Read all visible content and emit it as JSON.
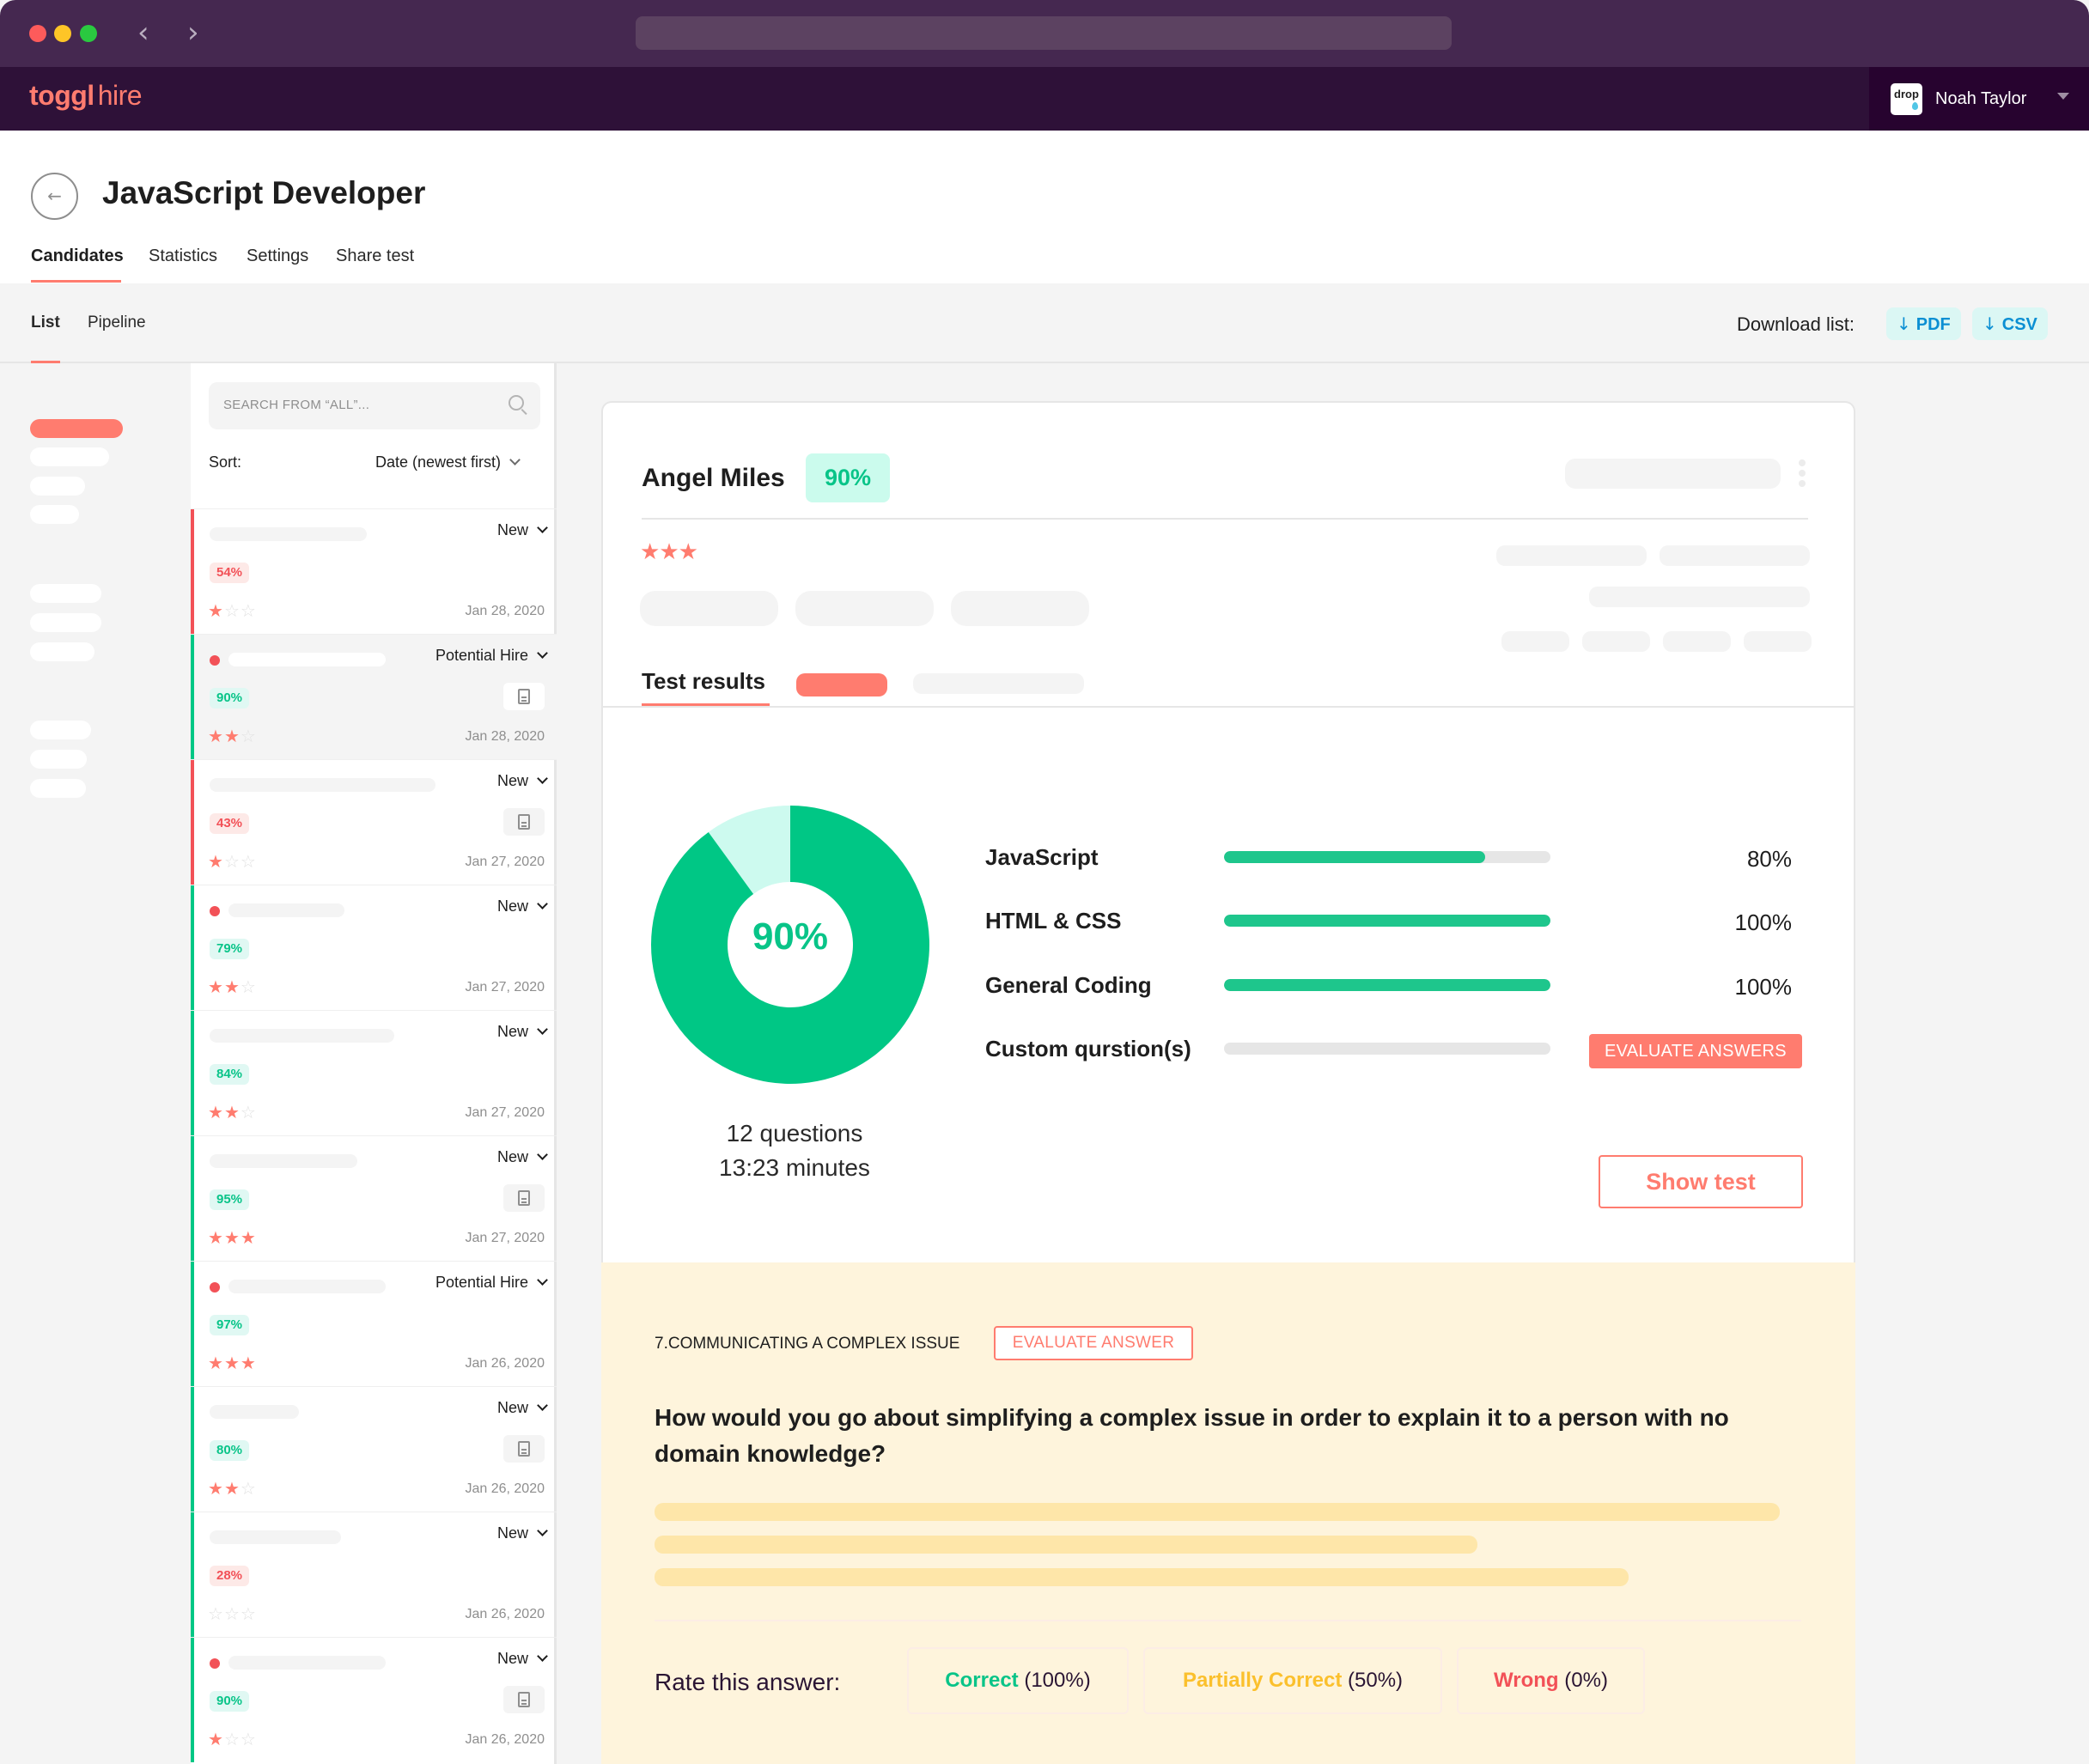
{
  "browser": {
    "nav_back_icon": "chevron-left-icon",
    "nav_forward_icon": "chevron-right-icon"
  },
  "app": {
    "logo_bold": "toggl",
    "logo_light": "hire",
    "user": {
      "avatar_text": "drop",
      "name": "Noah Taylor"
    }
  },
  "page": {
    "title": "JavaScript Developer",
    "tabs": [
      {
        "label": "Candidates",
        "active": true
      },
      {
        "label": "Statistics",
        "active": false
      },
      {
        "label": "Settings",
        "active": false
      },
      {
        "label": "Share test",
        "active": false
      }
    ],
    "subtabs": [
      {
        "label": "List",
        "active": true
      },
      {
        "label": "Pipeline",
        "active": false
      }
    ],
    "download": {
      "label": "Download list:",
      "pdf": "PDF",
      "csv": "CSV",
      "arrow": "↓"
    }
  },
  "list": {
    "search_placeholder": "SEARCH FROM “ALL”...",
    "sort_label": "Sort:",
    "sort_value": "Date (newest first)",
    "candidates": [
      {
        "status": "New",
        "score": "54%",
        "score_level": "bad",
        "stars": 1,
        "date": "Jan 28, 2020",
        "unread": false,
        "has_doc": false,
        "bar": "red",
        "selected": false
      },
      {
        "status": "Potential Hire",
        "score": "90%",
        "score_level": "good",
        "stars": 2,
        "date": "Jan 28, 2020",
        "unread": true,
        "has_doc": true,
        "bar": "green",
        "selected": true
      },
      {
        "status": "New",
        "score": "43%",
        "score_level": "bad",
        "stars": 1,
        "date": "Jan 27, 2020",
        "unread": false,
        "has_doc": true,
        "bar": "red",
        "selected": false
      },
      {
        "status": "New",
        "score": "79%",
        "score_level": "good",
        "stars": 2,
        "date": "Jan 27, 2020",
        "unread": true,
        "has_doc": false,
        "bar": "green",
        "selected": false
      },
      {
        "status": "New",
        "score": "84%",
        "score_level": "good",
        "stars": 2,
        "date": "Jan 27, 2020",
        "unread": false,
        "has_doc": false,
        "bar": "green",
        "selected": false
      },
      {
        "status": "New",
        "score": "95%",
        "score_level": "good",
        "stars": 3,
        "date": "Jan 27, 2020",
        "unread": false,
        "has_doc": true,
        "bar": "green",
        "selected": false
      },
      {
        "status": "Potential Hire",
        "score": "97%",
        "score_level": "good",
        "stars": 3,
        "date": "Jan 26, 2020",
        "unread": true,
        "has_doc": false,
        "bar": "green",
        "selected": false
      },
      {
        "status": "New",
        "score": "80%",
        "score_level": "good",
        "stars": 2,
        "date": "Jan 26, 2020",
        "unread": false,
        "has_doc": true,
        "bar": "green",
        "selected": false
      },
      {
        "status": "New",
        "score": "28%",
        "score_level": "bad",
        "stars": 0,
        "date": "Jan 26, 2020",
        "unread": false,
        "has_doc": false,
        "bar": "green",
        "selected": false
      },
      {
        "status": "New",
        "score": "90%",
        "score_level": "good",
        "stars": 1,
        "date": "Jan 26, 2020",
        "unread": true,
        "has_doc": true,
        "bar": "green",
        "selected": false
      }
    ]
  },
  "candidate": {
    "name": "Angel Miles",
    "score": "90%",
    "stars": 3,
    "results_tab": "Test results",
    "overall": {
      "label": "90%",
      "value_percent": 90,
      "questions": "12 questions",
      "duration": "13:23 minutes"
    },
    "skills": [
      {
        "name": "JavaScript",
        "percent": 80,
        "label": "80%"
      },
      {
        "name": "HTML & CSS",
        "percent": 100,
        "label": "100%"
      },
      {
        "name": "General Coding",
        "percent": 100,
        "label": "100%"
      },
      {
        "name": "Custom qurstion(s)",
        "percent": 0,
        "label": ""
      }
    ],
    "evaluate_answers": "EVALUATE ANSWERS",
    "show_test": "Show test"
  },
  "question": {
    "header": "7.COMMUNICATING A COMPLEX ISSUE",
    "evaluate_answer": "EVALUATE ANSWER",
    "text": "How would you go about simplifying a complex issue in order to explain it to a person with no domain knowledge?",
    "rate_label": "Rate this answer:",
    "ratings": [
      {
        "label": "Correct",
        "value": "(100%)",
        "color": "#08c488"
      },
      {
        "label": "Partially Correct",
        "value": "(50%)",
        "color": "#fbc02d"
      },
      {
        "label": "Wrong",
        "value": "(0%)",
        "color": "#f25157"
      }
    ]
  },
  "colors": {
    "accent": "#ff7c6f",
    "success": "#08c488",
    "danger": "#f25157",
    "link": "#0b8fd3",
    "header_bg": "#2e1138"
  }
}
